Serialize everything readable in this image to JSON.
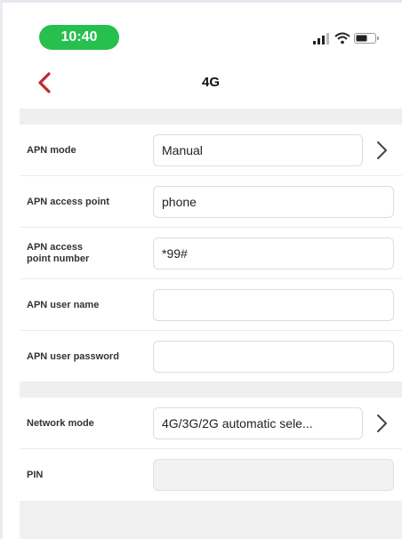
{
  "status_bar": {
    "time": "10:40"
  },
  "nav": {
    "title": "4G"
  },
  "apn": {
    "mode_label": "APN mode",
    "mode_value": "Manual",
    "access_point_label": "APN access point",
    "access_point_value": "phone",
    "access_point_number_label_line1": "APN access",
    "access_point_number_label_line2": "point number",
    "access_point_number_value": "*99#",
    "user_name_label": "APN user name",
    "user_name_value": "",
    "password_label": "APN user password",
    "password_value": ""
  },
  "network": {
    "mode_label": "Network mode",
    "mode_value": "4G/3G/2G automatic sele...",
    "pin_label": "PIN",
    "pin_value": ""
  },
  "colors": {
    "accent_green": "#27c04f",
    "back_red": "#c62828"
  }
}
